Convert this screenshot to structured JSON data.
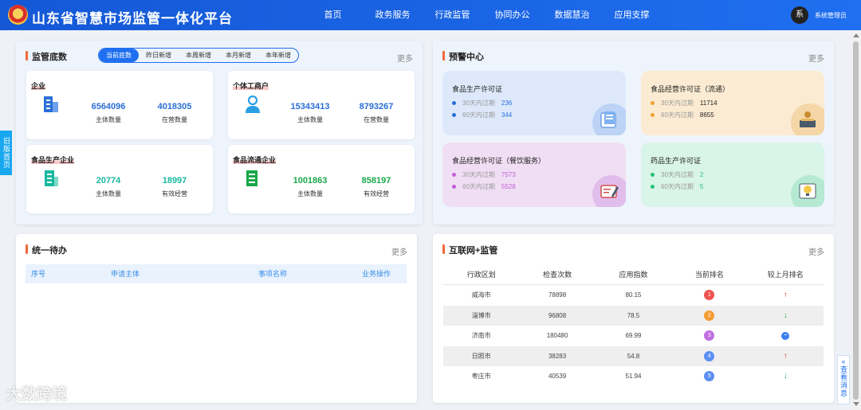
{
  "header": {
    "title": "山东省智慧市场监管一体化平台",
    "nav": [
      "首页",
      "政务服务",
      "行政监管",
      "协同办公",
      "数据慧治",
      "应用支撑"
    ],
    "avatar_text": "系",
    "user_name": "系统管理员",
    "colors": {
      "bar": "#1458d6"
    }
  },
  "side_tab": "旧版首页",
  "message_tab": {
    "chevron": "«",
    "label": "查看消息"
  },
  "supervision": {
    "title": "监管底数",
    "more": "更多",
    "tabs": [
      "当前底数",
      "昨日新增",
      "本周新增",
      "本月新增",
      "本年新增"
    ],
    "active_tab": "当前底数",
    "cards": [
      {
        "title": "企业",
        "icon": "building-icon",
        "v1": "6564096",
        "l1": "主体数量",
        "v2": "4018305",
        "l2": "在营数量",
        "color": "#2b6fd6"
      },
      {
        "title": "个体工商户",
        "icon": "person-icon",
        "v1": "15343413",
        "l1": "主体数量",
        "v2": "8793267",
        "l2": "在营数量",
        "color": "#2b6fd6"
      },
      {
        "title": "食品生产企业",
        "icon": "factory-icon",
        "v1": "20774",
        "l1": "主体数量",
        "v2": "18997",
        "l2": "有效经营",
        "color": "#18b8a0"
      },
      {
        "title": "食品流通企业",
        "icon": "store-icon",
        "v1": "1001863",
        "l1": "主体数量",
        "v2": "858197",
        "l2": "有效经营",
        "color": "#1aa64a"
      }
    ]
  },
  "warning": {
    "title": "预警中心",
    "more": "更多",
    "cards": [
      {
        "title": "食品生产许可证",
        "rows": [
          {
            "label": "30天内过期",
            "value": "236"
          },
          {
            "label": "60天内过期",
            "value": "344"
          }
        ],
        "dot_color": "#2b6fd6",
        "value_color": "#2b6fd6",
        "bg": "#dde9fb",
        "deco": "#bcd3f6",
        "icon": "document-icon"
      },
      {
        "title": "食品经营许可证（流通）",
        "rows": [
          {
            "label": "30天内过期",
            "value": "11714"
          },
          {
            "label": "60天内过期",
            "value": "8655"
          }
        ],
        "dot_color": "#f0a030",
        "value_color": "#222222",
        "bg": "#fbebd2",
        "deco": "#f5d6a6",
        "icon": "cashier-icon"
      },
      {
        "title": "食品经营许可证（餐饮服务）",
        "rows": [
          {
            "label": "30天内过期",
            "value": "7573"
          },
          {
            "label": "60天内过期",
            "value": "5528"
          }
        ],
        "dot_color": "#c05ed6",
        "value_color": "#c05ed6",
        "bg": "#f0def4",
        "deco": "#e1bdeb",
        "icon": "certificate-icon"
      },
      {
        "title": "药品生产许可证",
        "rows": [
          {
            "label": "30天内过期",
            "value": "2"
          },
          {
            "label": "60天内过期",
            "value": "5"
          }
        ],
        "dot_color": "#26c07a",
        "value_color": "#26c07a",
        "bg": "#d9f4e8",
        "deco": "#b5e9d1",
        "icon": "lightbulb-icon"
      }
    ]
  },
  "todo": {
    "title": "统一待办",
    "more": "更多",
    "columns": [
      "序号",
      "申请主体",
      "事项名称",
      "业务操作"
    ]
  },
  "internet": {
    "title": "互联网+监管",
    "more": "更多",
    "columns": [
      "行政区划",
      "检查次数",
      "应用指数",
      "当前排名",
      "较上月排名"
    ],
    "rows": [
      {
        "region": "威海市",
        "checks": "78898",
        "index": "80.15",
        "rank": "1",
        "rank_color": "#ef5350",
        "trend": "↑",
        "trend_type": "up"
      },
      {
        "region": "淄博市",
        "checks": "96808",
        "index": "78.5",
        "rank": "2",
        "rank_color": "#f39c32",
        "trend": "↓",
        "trend_type": "down"
      },
      {
        "region": "济南市",
        "checks": "180480",
        "index": "69.99",
        "rank": "3",
        "rank_color": "#c06ee0",
        "trend": "−",
        "trend_type": "flat"
      },
      {
        "region": "日照市",
        "checks": "38283",
        "index": "54.8",
        "rank": "4",
        "rank_color": "#5c8ff0",
        "trend": "↑",
        "trend_type": "up"
      },
      {
        "region": "枣庄市",
        "checks": "40539",
        "index": "51.94",
        "rank": "5",
        "rank_color": "#5c8ff0",
        "trend": "↓",
        "trend_type": "down"
      }
    ]
  },
  "watermark": "大数跨境"
}
